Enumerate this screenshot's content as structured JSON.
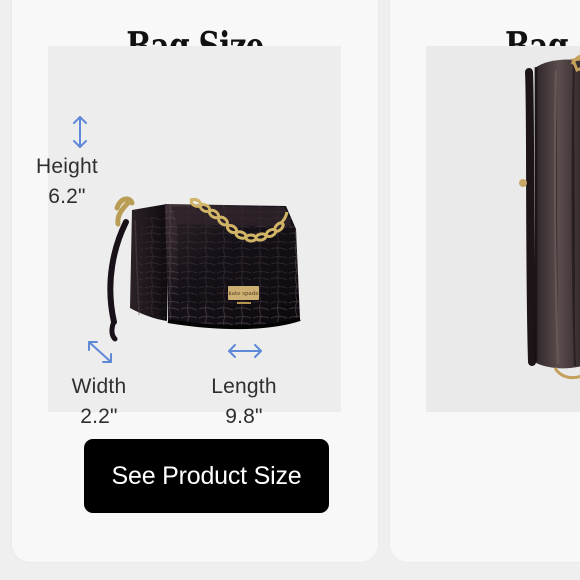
{
  "cards": [
    {
      "title": "Bag Size",
      "dimensions": {
        "height": {
          "label": "Height",
          "value": "6.2\""
        },
        "width": {
          "label": "Width",
          "value": "2.2\""
        },
        "length": {
          "label": "Length",
          "value": "9.8\""
        }
      },
      "button_label": "See Product Size"
    },
    {
      "title": "Bag Si"
    }
  ],
  "colors": {
    "page_background": "#efefef",
    "card_background": "#f8f8f8",
    "image_background": "#ededed",
    "dimension_arrow": "#5d89d7",
    "button_background": "#000000",
    "button_text": "#ffffff"
  },
  "icons": {
    "height": "vertical-double-arrow-icon",
    "width": "diagonal-double-arrow-icon",
    "length": "horizontal-double-arrow-icon"
  }
}
